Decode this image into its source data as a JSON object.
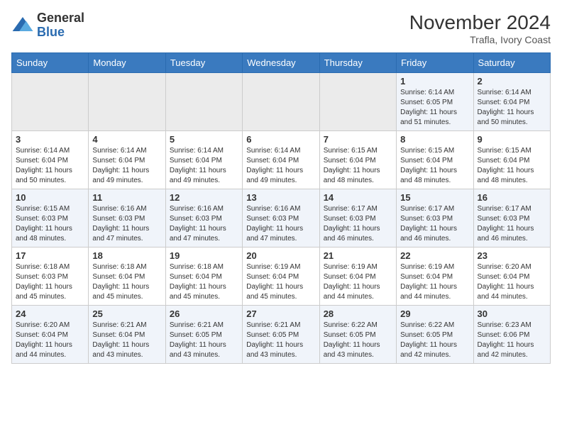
{
  "header": {
    "logo_general": "General",
    "logo_blue": "Blue",
    "month_year": "November 2024",
    "location": "Trafla, Ivory Coast"
  },
  "days_of_week": [
    "Sunday",
    "Monday",
    "Tuesday",
    "Wednesday",
    "Thursday",
    "Friday",
    "Saturday"
  ],
  "weeks": [
    [
      {
        "day": "",
        "info": ""
      },
      {
        "day": "",
        "info": ""
      },
      {
        "day": "",
        "info": ""
      },
      {
        "day": "",
        "info": ""
      },
      {
        "day": "",
        "info": ""
      },
      {
        "day": "1",
        "info": "Sunrise: 6:14 AM\nSunset: 6:05 PM\nDaylight: 11 hours\nand 51 minutes."
      },
      {
        "day": "2",
        "info": "Sunrise: 6:14 AM\nSunset: 6:04 PM\nDaylight: 11 hours\nand 50 minutes."
      }
    ],
    [
      {
        "day": "3",
        "info": "Sunrise: 6:14 AM\nSunset: 6:04 PM\nDaylight: 11 hours\nand 50 minutes."
      },
      {
        "day": "4",
        "info": "Sunrise: 6:14 AM\nSunset: 6:04 PM\nDaylight: 11 hours\nand 49 minutes."
      },
      {
        "day": "5",
        "info": "Sunrise: 6:14 AM\nSunset: 6:04 PM\nDaylight: 11 hours\nand 49 minutes."
      },
      {
        "day": "6",
        "info": "Sunrise: 6:14 AM\nSunset: 6:04 PM\nDaylight: 11 hours\nand 49 minutes."
      },
      {
        "day": "7",
        "info": "Sunrise: 6:15 AM\nSunset: 6:04 PM\nDaylight: 11 hours\nand 48 minutes."
      },
      {
        "day": "8",
        "info": "Sunrise: 6:15 AM\nSunset: 6:04 PM\nDaylight: 11 hours\nand 48 minutes."
      },
      {
        "day": "9",
        "info": "Sunrise: 6:15 AM\nSunset: 6:04 PM\nDaylight: 11 hours\nand 48 minutes."
      }
    ],
    [
      {
        "day": "10",
        "info": "Sunrise: 6:15 AM\nSunset: 6:03 PM\nDaylight: 11 hours\nand 48 minutes."
      },
      {
        "day": "11",
        "info": "Sunrise: 6:16 AM\nSunset: 6:03 PM\nDaylight: 11 hours\nand 47 minutes."
      },
      {
        "day": "12",
        "info": "Sunrise: 6:16 AM\nSunset: 6:03 PM\nDaylight: 11 hours\nand 47 minutes."
      },
      {
        "day": "13",
        "info": "Sunrise: 6:16 AM\nSunset: 6:03 PM\nDaylight: 11 hours\nand 47 minutes."
      },
      {
        "day": "14",
        "info": "Sunrise: 6:17 AM\nSunset: 6:03 PM\nDaylight: 11 hours\nand 46 minutes."
      },
      {
        "day": "15",
        "info": "Sunrise: 6:17 AM\nSunset: 6:03 PM\nDaylight: 11 hours\nand 46 minutes."
      },
      {
        "day": "16",
        "info": "Sunrise: 6:17 AM\nSunset: 6:03 PM\nDaylight: 11 hours\nand 46 minutes."
      }
    ],
    [
      {
        "day": "17",
        "info": "Sunrise: 6:18 AM\nSunset: 6:03 PM\nDaylight: 11 hours\nand 45 minutes."
      },
      {
        "day": "18",
        "info": "Sunrise: 6:18 AM\nSunset: 6:04 PM\nDaylight: 11 hours\nand 45 minutes."
      },
      {
        "day": "19",
        "info": "Sunrise: 6:18 AM\nSunset: 6:04 PM\nDaylight: 11 hours\nand 45 minutes."
      },
      {
        "day": "20",
        "info": "Sunrise: 6:19 AM\nSunset: 6:04 PM\nDaylight: 11 hours\nand 45 minutes."
      },
      {
        "day": "21",
        "info": "Sunrise: 6:19 AM\nSunset: 6:04 PM\nDaylight: 11 hours\nand 44 minutes."
      },
      {
        "day": "22",
        "info": "Sunrise: 6:19 AM\nSunset: 6:04 PM\nDaylight: 11 hours\nand 44 minutes."
      },
      {
        "day": "23",
        "info": "Sunrise: 6:20 AM\nSunset: 6:04 PM\nDaylight: 11 hours\nand 44 minutes."
      }
    ],
    [
      {
        "day": "24",
        "info": "Sunrise: 6:20 AM\nSunset: 6:04 PM\nDaylight: 11 hours\nand 44 minutes."
      },
      {
        "day": "25",
        "info": "Sunrise: 6:21 AM\nSunset: 6:04 PM\nDaylight: 11 hours\nand 43 minutes."
      },
      {
        "day": "26",
        "info": "Sunrise: 6:21 AM\nSunset: 6:05 PM\nDaylight: 11 hours\nand 43 minutes."
      },
      {
        "day": "27",
        "info": "Sunrise: 6:21 AM\nSunset: 6:05 PM\nDaylight: 11 hours\nand 43 minutes."
      },
      {
        "day": "28",
        "info": "Sunrise: 6:22 AM\nSunset: 6:05 PM\nDaylight: 11 hours\nand 43 minutes."
      },
      {
        "day": "29",
        "info": "Sunrise: 6:22 AM\nSunset: 6:05 PM\nDaylight: 11 hours\nand 42 minutes."
      },
      {
        "day": "30",
        "info": "Sunrise: 6:23 AM\nSunset: 6:06 PM\nDaylight: 11 hours\nand 42 minutes."
      }
    ]
  ]
}
